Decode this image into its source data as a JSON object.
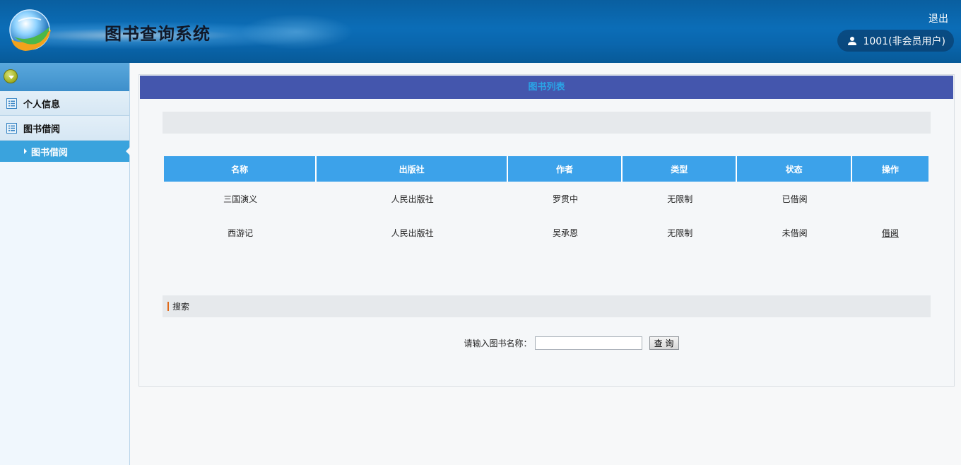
{
  "header": {
    "title": "图书查询系统",
    "logout_label": "退出",
    "user_label": "1001(非会员用户)"
  },
  "sidebar": {
    "items": [
      {
        "label": "个人信息",
        "icon": "list-icon"
      },
      {
        "label": "图书借阅",
        "icon": "list-icon"
      }
    ],
    "active_sub": {
      "label": "图书借阅"
    }
  },
  "main": {
    "panel_title": "图书列表",
    "table": {
      "columns": [
        "名称",
        "出版社",
        "作者",
        "类型",
        "状态",
        "操作"
      ],
      "rows": [
        {
          "name": "三国演义",
          "publisher": "人民出版社",
          "author": "罗贯中",
          "type": "无限制",
          "status": "已借阅",
          "action": ""
        },
        {
          "name": "西游记",
          "publisher": "人民出版社",
          "author": "吴承恩",
          "type": "无限制",
          "status": "未借阅",
          "action": "借阅"
        }
      ]
    },
    "search": {
      "section_label": "搜索",
      "field_label": "请输入图书名称：",
      "input_value": "",
      "button_label": "查 询"
    }
  },
  "colors": {
    "header_blue": "#0b6db7",
    "panel_title_bg": "#4456ad",
    "panel_title_text": "#2aa4e6",
    "table_header_bg": "#3ca2ea",
    "sidebar_active": "#3aa3dd"
  }
}
